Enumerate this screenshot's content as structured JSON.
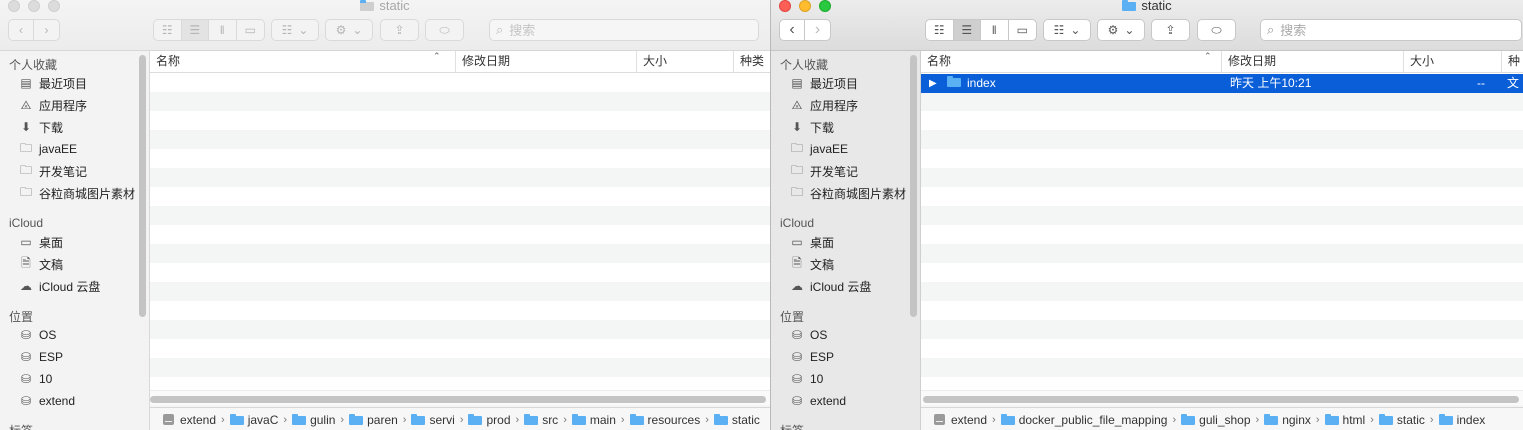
{
  "left": {
    "title": "static",
    "search_placeholder": "搜索",
    "sidebar": {
      "favorites_header": "个人收藏",
      "favorites": [
        {
          "label": "最近项目",
          "icon": "recents-icon"
        },
        {
          "label": "应用程序",
          "icon": "applications-icon"
        },
        {
          "label": "下载",
          "icon": "downloads-icon"
        },
        {
          "label": "javaEE",
          "icon": "folder-icon"
        },
        {
          "label": "开发笔记",
          "icon": "folder-icon"
        },
        {
          "label": "谷粒商城图片素材",
          "icon": "folder-icon"
        }
      ],
      "icloud_header": "iCloud",
      "icloud": [
        {
          "label": "桌面",
          "icon": "desktop-icon"
        },
        {
          "label": "文稿",
          "icon": "documents-icon"
        },
        {
          "label": "iCloud 云盘",
          "icon": "cloud-icon"
        }
      ],
      "locations_header": "位置",
      "locations": [
        {
          "label": "OS",
          "icon": "disk-icon"
        },
        {
          "label": "ESP",
          "icon": "disk-icon"
        },
        {
          "label": "10",
          "icon": "disk-icon"
        },
        {
          "label": "extend",
          "icon": "disk-icon"
        }
      ],
      "tags_header": "标签"
    },
    "columns": {
      "name": "名称",
      "date": "修改日期",
      "size": "大小",
      "kind": "种类"
    },
    "path": [
      "extend",
      "javaC",
      "gulin",
      "paren",
      "servi",
      "prod",
      "src",
      "main",
      "resources",
      "static"
    ]
  },
  "right": {
    "title": "static",
    "search_placeholder": "搜索",
    "sidebar": {
      "favorites_header": "个人收藏",
      "favorites": [
        {
          "label": "最近项目",
          "icon": "recents-icon"
        },
        {
          "label": "应用程序",
          "icon": "applications-icon"
        },
        {
          "label": "下载",
          "icon": "downloads-icon"
        },
        {
          "label": "javaEE",
          "icon": "folder-icon"
        },
        {
          "label": "开发笔记",
          "icon": "folder-icon"
        },
        {
          "label": "谷粒商城图片素材",
          "icon": "folder-icon"
        }
      ],
      "icloud_header": "iCloud",
      "icloud": [
        {
          "label": "桌面",
          "icon": "desktop-icon"
        },
        {
          "label": "文稿",
          "icon": "documents-icon"
        },
        {
          "label": "iCloud 云盘",
          "icon": "cloud-icon"
        }
      ],
      "locations_header": "位置",
      "locations": [
        {
          "label": "OS",
          "icon": "disk-icon"
        },
        {
          "label": "ESP",
          "icon": "disk-icon"
        },
        {
          "label": "10",
          "icon": "disk-icon"
        },
        {
          "label": "extend",
          "icon": "disk-icon"
        }
      ],
      "tags_header": "标签"
    },
    "columns": {
      "name": "名称",
      "date": "修改日期",
      "size": "大小",
      "kind": "种类"
    },
    "files": [
      {
        "name": "index",
        "date": "昨天 上午10:21",
        "size": "--",
        "kind": "文"
      }
    ],
    "path": [
      "extend",
      "docker_public_file_mapping",
      "guli_shop",
      "nginx",
      "html",
      "static",
      "index"
    ]
  },
  "colors": {
    "selection": "#0a5fd9",
    "folder": "#5ab0f2"
  }
}
